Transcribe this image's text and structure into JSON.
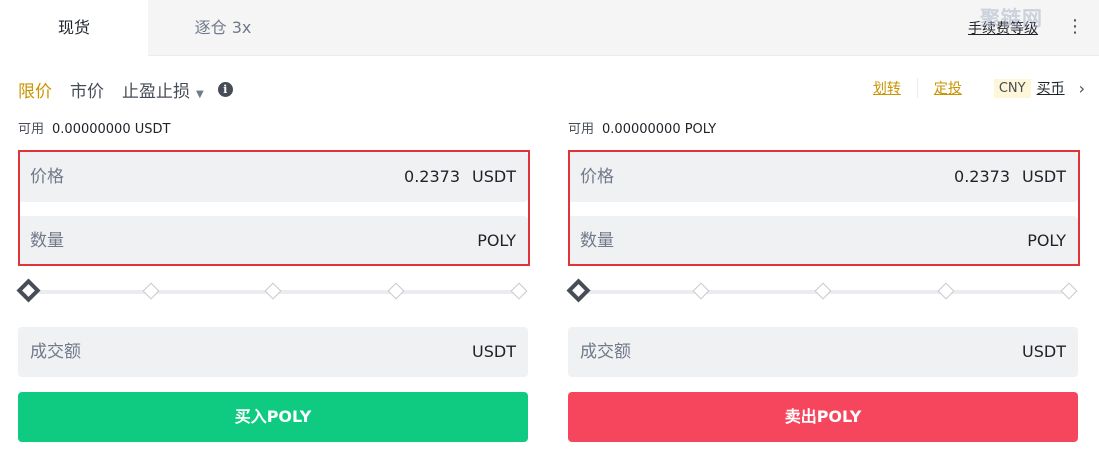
{
  "tabs": {
    "spot": "现货",
    "isolated": "逐仓 3x"
  },
  "header": {
    "fee_level": "手续费等级",
    "watermark": "聚链网"
  },
  "order_types": {
    "limit": "限价",
    "market": "市价",
    "stop": "止盈止损"
  },
  "top_links": {
    "transfer": "划转",
    "auto_invest": "定投",
    "currency": "CNY",
    "buy_crypto": "买币"
  },
  "buy_panel": {
    "available_label": "可用",
    "available_value": "0.00000000 USDT",
    "price_label": "价格",
    "price_value": "0.2373",
    "price_unit": "USDT",
    "qty_label": "数量",
    "qty_unit": "POLY",
    "total_label": "成交额",
    "total_unit": "USDT",
    "slider_percent": 0,
    "button": "买入POLY"
  },
  "sell_panel": {
    "available_label": "可用",
    "available_value": "0.00000000 POLY",
    "price_label": "价格",
    "price_value": "0.2373",
    "price_unit": "USDT",
    "qty_label": "数量",
    "qty_unit": "POLY",
    "total_label": "成交额",
    "total_unit": "USDT",
    "slider_percent": 0,
    "button": "卖出POLY"
  },
  "colors": {
    "accent": "#c99400",
    "buy": "#0ecb81",
    "sell": "#f6465d",
    "highlight": "#e0333a"
  }
}
